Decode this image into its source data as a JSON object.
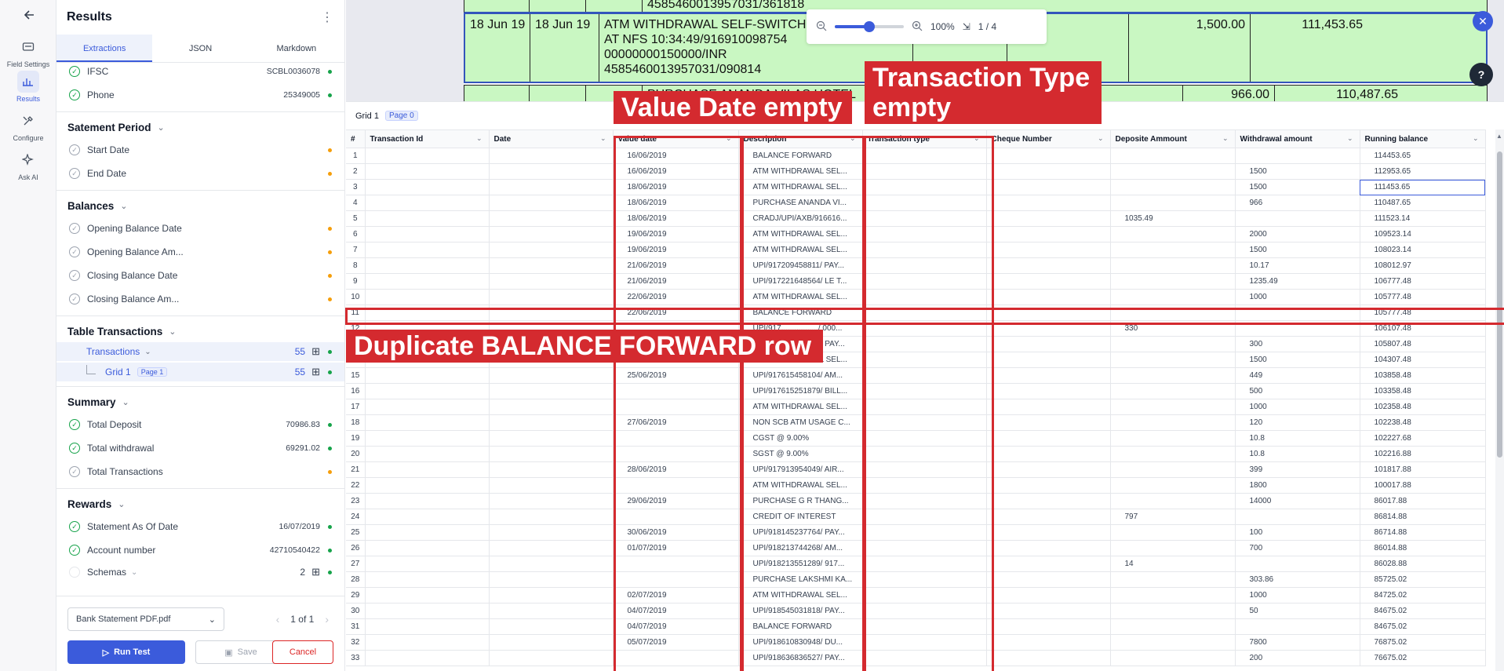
{
  "rail": {
    "items": [
      {
        "label": "Field Settings",
        "icon": "field-settings-icon"
      },
      {
        "label": "Results",
        "icon": "results-icon"
      },
      {
        "label": "Configure",
        "icon": "configure-icon"
      },
      {
        "label": "Ask AI",
        "icon": "sparkle-icon"
      }
    ]
  },
  "panel": {
    "title": "Results",
    "tabs": [
      "Extractions",
      "JSON",
      "Markdown"
    ],
    "top_fields": [
      {
        "name": "IFSC",
        "value": "SCBL0036078",
        "status": "done",
        "dot": "green"
      },
      {
        "name": "Phone",
        "value": "25349005",
        "status": "done",
        "dot": "green"
      }
    ],
    "statement_period": {
      "title": "Satement Period",
      "fields": [
        {
          "name": "Start Date",
          "value": "",
          "status": "pending",
          "dot": "amber"
        },
        {
          "name": "End Date",
          "value": "",
          "status": "pending",
          "dot": "amber"
        }
      ]
    },
    "balances": {
      "title": "Balances",
      "fields": [
        {
          "name": "Opening Balance Date",
          "value": "",
          "status": "pending",
          "dot": "amber"
        },
        {
          "name": "Opening Balance Am...",
          "value": "",
          "status": "pending",
          "dot": "amber"
        },
        {
          "name": "Closing Balance Date",
          "value": "",
          "status": "pending",
          "dot": "amber"
        },
        {
          "name": "Closing Balance Am...",
          "value": "",
          "status": "pending",
          "dot": "amber"
        }
      ]
    },
    "table_transactions": {
      "title": "Table Transactions",
      "transactions_label": "Transactions",
      "transactions_count": "55",
      "grid_label": "Grid 1",
      "grid_page": "Page 1",
      "grid_count": "55"
    },
    "summary": {
      "title": "Summary",
      "fields": [
        {
          "name": "Total Deposit",
          "value": "70986.83",
          "status": "done",
          "dot": "green"
        },
        {
          "name": "Total withdrawal",
          "value": "69291.02",
          "status": "done",
          "dot": "green"
        },
        {
          "name": "Total Transactions",
          "value": "",
          "status": "pending",
          "dot": "amber"
        }
      ]
    },
    "rewards": {
      "title": "Rewards",
      "fields": [
        {
          "name": "Statement As Of Date",
          "value": "16/07/2019",
          "status": "done",
          "dot": "green"
        },
        {
          "name": "Account number",
          "value": "42710540422",
          "status": "done",
          "dot": "green"
        }
      ],
      "schemas_label": "Schemas",
      "schemas_count": "2"
    },
    "footer": {
      "file": "Bank Statement PDF.pdf",
      "pager": "1 of 1",
      "run": "Run Test",
      "save": "Save",
      "cancel": "Cancel"
    }
  },
  "viewer": {
    "doc_lines": {
      "row0_desc": "4585460013957031/361818",
      "row1_date1": "18 Jun 19",
      "row1_date2": "18 Jun 19",
      "row1_desc": "ATM WITHDRAWAL SELF-SWITCH\nAT NFS 10:34:49/916910098754\n00000000150000/INR\n4585460013957031/090814",
      "row1_withdrawal": "1,500.00",
      "row1_balance": "111,453.65",
      "row2_desc": "PURCHASE ANANDA VILAS HOTEL",
      "row2_withdrawal": "966.00",
      "row2_balance": "110,487.65"
    },
    "zoom": "100%",
    "zoom_level": 0.5,
    "page_indicator": "1 / 4"
  },
  "grid": {
    "title": "Grid 1",
    "page": "Page 0",
    "columns": [
      "#",
      "Transaction Id",
      "Date",
      "Value date",
      "Description",
      "Transaction type",
      "Cheque Number",
      "Deposite Ammount",
      "Withdrawal amount",
      "Running balance"
    ],
    "rows": [
      [
        "1",
        "",
        "",
        "16/06/2019",
        "BALANCE FORWARD",
        "",
        "",
        "",
        "",
        "114453.65"
      ],
      [
        "2",
        "",
        "",
        "16/06/2019",
        "ATM WITHDRAWAL SEL...",
        "",
        "",
        "",
        "1500",
        "112953.65"
      ],
      [
        "3",
        "",
        "",
        "18/06/2019",
        "ATM WITHDRAWAL SEL...",
        "",
        "",
        "",
        "1500",
        "111453.65"
      ],
      [
        "4",
        "",
        "",
        "18/06/2019",
        "PURCHASE ANANDA VI...",
        "",
        "",
        "",
        "966",
        "110487.65"
      ],
      [
        "5",
        "",
        "",
        "18/06/2019",
        "CRADJ/UPI/AXB/916616...",
        "",
        "",
        "1035.49",
        "",
        "111523.14"
      ],
      [
        "6",
        "",
        "",
        "19/06/2019",
        "ATM WITHDRAWAL SEL...",
        "",
        "",
        "",
        "2000",
        "109523.14"
      ],
      [
        "7",
        "",
        "",
        "19/06/2019",
        "ATM WITHDRAWAL SEL...",
        "",
        "",
        "",
        "1500",
        "108023.14"
      ],
      [
        "8",
        "",
        "",
        "21/06/2019",
        "UPI/917209458811/ PAY...",
        "",
        "",
        "",
        "10.17",
        "108012.97"
      ],
      [
        "9",
        "",
        "",
        "21/06/2019",
        "UPI/917221648564/ LE T...",
        "",
        "",
        "",
        "1235.49",
        "106777.48"
      ],
      [
        "10",
        "",
        "",
        "22/06/2019",
        "ATM WITHDRAWAL SEL...",
        "",
        "",
        "",
        "1000",
        "105777.48"
      ],
      [
        "11",
        "",
        "",
        "22/06/2019",
        "BALANCE FORWARD",
        "",
        "",
        "",
        "",
        "105777.48"
      ],
      [
        "12",
        "",
        "",
        "",
        "UPI/917................./ 000...",
        "",
        "",
        "330",
        "",
        "106107.48"
      ],
      [
        "13",
        "",
        "",
        "",
        "UPI/917................../ PAY...",
        "",
        "",
        "",
        "300",
        "105807.48"
      ],
      [
        "14",
        "",
        "",
        "",
        "ATM WITHDRAWAL SEL...",
        "",
        "",
        "",
        "1500",
        "104307.48"
      ],
      [
        "15",
        "",
        "",
        "25/06/2019",
        "UPI/917615458104/ AM...",
        "",
        "",
        "",
        "449",
        "103858.48"
      ],
      [
        "16",
        "",
        "",
        "",
        "UPI/917615251879/ BILL...",
        "",
        "",
        "",
        "500",
        "103358.48"
      ],
      [
        "17",
        "",
        "",
        "",
        "ATM WITHDRAWAL SEL...",
        "",
        "",
        "",
        "1000",
        "102358.48"
      ],
      [
        "18",
        "",
        "",
        "27/06/2019",
        "NON SCB ATM USAGE C...",
        "",
        "",
        "",
        "120",
        "102238.48"
      ],
      [
        "19",
        "",
        "",
        "",
        "CGST @ 9.00%",
        "",
        "",
        "",
        "10.8",
        "102227.68"
      ],
      [
        "20",
        "",
        "",
        "",
        "SGST @ 9.00%",
        "",
        "",
        "",
        "10.8",
        "102216.88"
      ],
      [
        "21",
        "",
        "",
        "28/06/2019",
        "UPI/917913954049/ AIR...",
        "",
        "",
        "",
        "399",
        "101817.88"
      ],
      [
        "22",
        "",
        "",
        "",
        "ATM WITHDRAWAL SEL...",
        "",
        "",
        "",
        "1800",
        "100017.88"
      ],
      [
        "23",
        "",
        "",
        "29/06/2019",
        "PURCHASE G R THANG...",
        "",
        "",
        "",
        "14000",
        "86017.88"
      ],
      [
        "24",
        "",
        "",
        "",
        "CREDIT OF INTEREST",
        "",
        "",
        "797",
        "",
        "86814.88"
      ],
      [
        "25",
        "",
        "",
        "30/06/2019",
        "UPI/918145237764/ PAY...",
        "",
        "",
        "",
        "100",
        "86714.88"
      ],
      [
        "26",
        "",
        "",
        "01/07/2019",
        "UPI/918213744268/ AM...",
        "",
        "",
        "",
        "700",
        "86014.88"
      ],
      [
        "27",
        "",
        "",
        "",
        "UPI/918213551289/ 917...",
        "",
        "",
        "14",
        "",
        "86028.88"
      ],
      [
        "28",
        "",
        "",
        "",
        "PURCHASE LAKSHMI KA...",
        "",
        "",
        "",
        "303.86",
        "85725.02"
      ],
      [
        "29",
        "",
        "",
        "02/07/2019",
        "ATM WITHDRAWAL SEL...",
        "",
        "",
        "",
        "1000",
        "84725.02"
      ],
      [
        "30",
        "",
        "",
        "04/07/2019",
        "UPI/918545031818/ PAY...",
        "",
        "",
        "",
        "50",
        "84675.02"
      ],
      [
        "31",
        "",
        "",
        "04/07/2019",
        "BALANCE FORWARD",
        "",
        "",
        "",
        "",
        "84675.02"
      ],
      [
        "32",
        "",
        "",
        "05/07/2019",
        "UPI/918610830948/ DU...",
        "",
        "",
        "",
        "7800",
        "76875.02"
      ],
      [
        "33",
        "",
        "",
        "",
        "UPI/918636836527/ PAY...",
        "",
        "",
        "",
        "200",
        "76675.02"
      ]
    ]
  },
  "annotations": {
    "value_date": "Value Date empty",
    "transaction_type": "Transaction Type\nempty",
    "duplicate": "Duplicate BALANCE FORWARD row",
    "color": "#d42a2f"
  }
}
